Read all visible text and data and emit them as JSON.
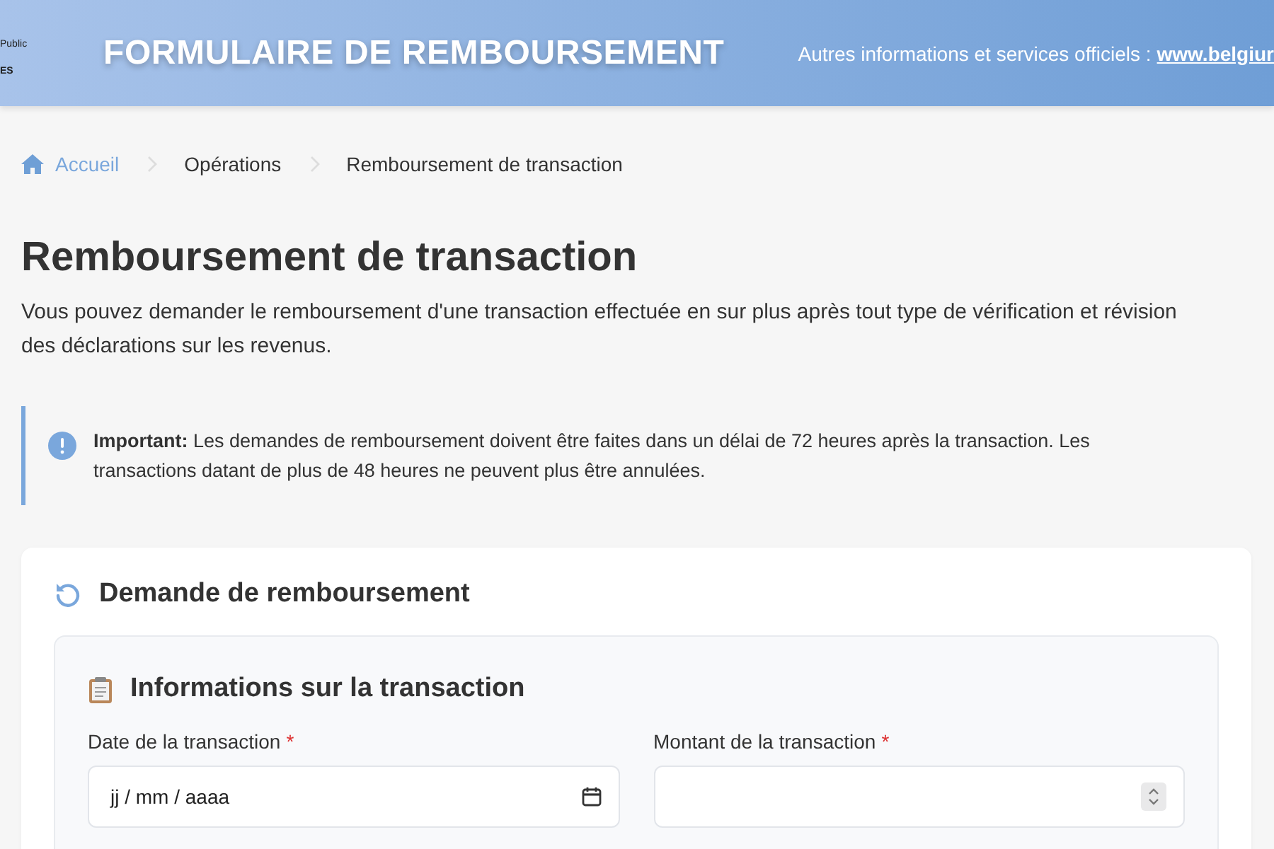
{
  "header": {
    "logo_lines": [
      "Public",
      "ES"
    ],
    "title": "FORMULAIRE DE REMBOURSEMENT",
    "info_text": "Autres informations et services officiels :",
    "info_link": "www.belgiur"
  },
  "breadcrumb": [
    {
      "label": "Accueil",
      "kind": "home"
    },
    {
      "label": "Opérations",
      "kind": "link"
    },
    {
      "label": "Remboursement de transaction",
      "kind": "current"
    }
  ],
  "page": {
    "title": "Remboursement de transaction",
    "description": "Vous pouvez demander le remboursement d'une transaction effectuée en sur plus après tout type de vérification et révision des déclarations sur les revenus."
  },
  "alert": {
    "text": "**Important:** Les demandes de remboursement doivent être faites dans un délai de 72 heures après la transaction. Les transactions datant de plus de 48 heures ne peuvent plus être annulées."
  },
  "form": {
    "title": "Demande de remboursement",
    "section": {
      "title": "Informations sur la transaction",
      "fields": [
        {
          "label": "Date de la transaction",
          "required_mark": "*",
          "kind": "date",
          "placeholder": "jj / mm / aaaa"
        },
        {
          "label": "Montant de la transaction",
          "required_mark": "*",
          "kind": "number"
        }
      ]
    }
  }
}
